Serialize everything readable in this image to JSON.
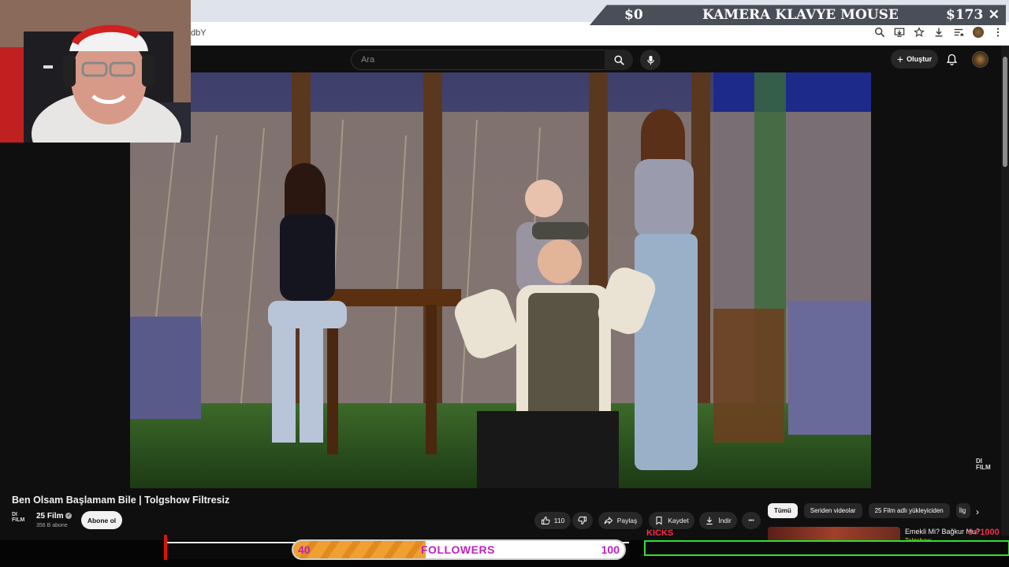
{
  "browser": {
    "url_fragment": "dbY",
    "icons": [
      "zoom-icon",
      "install-icon",
      "bookmark-star-icon",
      "download-icon",
      "reading-list-icon",
      "profile-avatar",
      "menu-icon"
    ]
  },
  "overlay_banner": {
    "left_value": "$0",
    "title": "KAMERA KLAVYE MOUSE",
    "right_value": "$173",
    "close": "✕"
  },
  "header": {
    "search_placeholder": "Ara",
    "create_label": "Oluştur"
  },
  "video": {
    "title": "Ben Olsam Başlamam Bile | Tolgshow Filtresiz",
    "watermark": "DI\nFILM"
  },
  "channel": {
    "logo": "DI\nFILM",
    "name": "25 Film",
    "subscribers": "356 B abone",
    "subscribe_label": "Abone ol"
  },
  "actions": {
    "likes": "110",
    "share": "Paylaş",
    "save": "Kaydet",
    "download": "İndir",
    "more": "•••"
  },
  "chips": [
    "Tümü",
    "Seriden videolar",
    "25 Film adlı yükleyiciden",
    "İlg"
  ],
  "recommendation": {
    "title": "Emekli Mi? Bağkur Mu?",
    "channel": "Tolgshow"
  },
  "followers_goal": {
    "current": "40",
    "label": "FOLLOWERS",
    "target": "100",
    "progress": 0.4
  },
  "kicks": {
    "label": "KICKS",
    "count": "0 / 1000"
  },
  "colors": {
    "accent_magenta": "#c020c0",
    "kicks_red": "#ff2a4a",
    "kicks_green": "#2ee02e",
    "progress_orange": "#f0a030"
  }
}
